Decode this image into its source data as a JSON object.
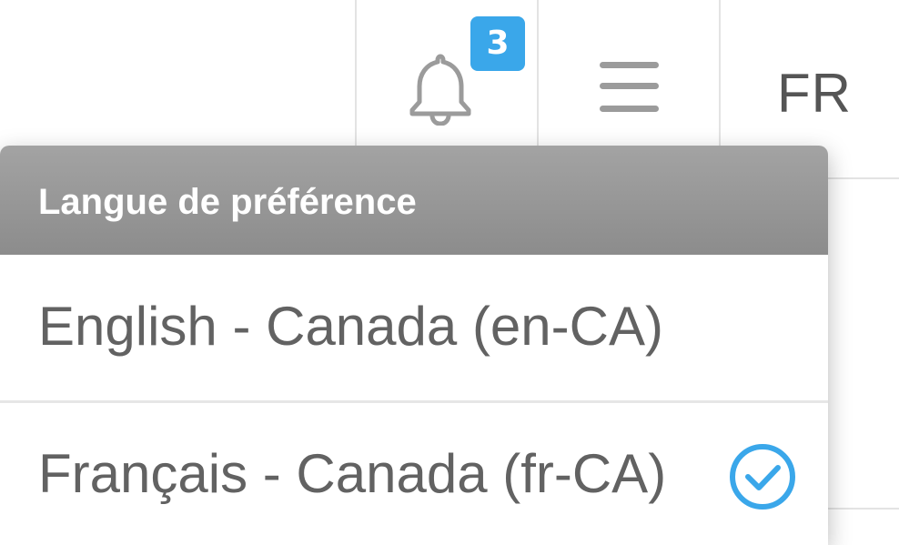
{
  "notifications": {
    "count": "3",
    "icon": "bell-icon"
  },
  "menu": {
    "icon": "hamburger-menu-icon"
  },
  "language_button": {
    "label": "FR"
  },
  "dropdown": {
    "header": "Langue de préférence",
    "options": [
      {
        "label": "English - Canada (en-CA)",
        "selected": false
      },
      {
        "label": "Français - Canada (fr-CA)",
        "selected": true
      }
    ]
  },
  "colors": {
    "accent": "#3aa7ea",
    "header_bg": "#999999",
    "text": "#626262",
    "icon": "#9b9b9b"
  }
}
